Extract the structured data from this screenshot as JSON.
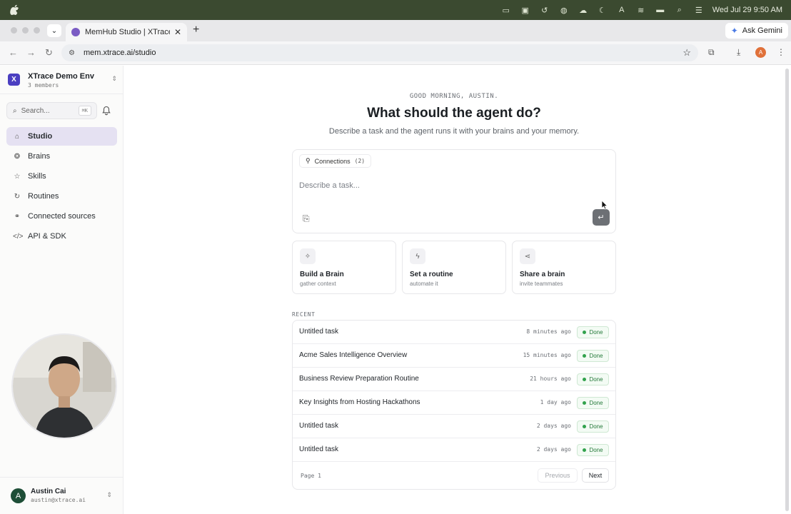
{
  "menubar": {
    "clock": "Wed Jul 29  9:50 AM"
  },
  "browser": {
    "tab_title": "MemHub Studio | XTrace Mem",
    "url": "mem.xtrace.ai/studio",
    "ask_gemini": "Ask Gemini",
    "profile_initial": "A"
  },
  "sidebar": {
    "workspace_logo": "X",
    "workspace_name": "XTrace Demo Env",
    "workspace_members": "3 members",
    "search_placeholder": "Search...",
    "search_shortcut": "⌘K",
    "items": [
      {
        "label": "Studio",
        "icon": "home-icon",
        "active": true
      },
      {
        "label": "Brains",
        "icon": "brain-icon"
      },
      {
        "label": "Skills",
        "icon": "star-icon"
      },
      {
        "label": "Routines",
        "icon": "refresh-icon"
      },
      {
        "label": "Connected sources",
        "icon": "link-icon"
      },
      {
        "label": "API & SDK",
        "icon": "code-icon"
      }
    ],
    "user": {
      "initial": "A",
      "name": "Austin Cai",
      "email": "austin@xtrace.ai"
    }
  },
  "main": {
    "greeting": "GOOD MORNING, AUSTIN.",
    "headline": "What should the agent do?",
    "subline": "Describe a task and the agent runs it with your brains and your memory.",
    "composer": {
      "connections_label": "Connections",
      "connections_count": "(2)",
      "placeholder": "Describe a task...",
      "value": ""
    },
    "cards": [
      {
        "title": "Build a Brain",
        "subtitle": "gather context",
        "icon": "sparkle-icon"
      },
      {
        "title": "Set a routine",
        "subtitle": "automate it",
        "icon": "bolt-icon"
      },
      {
        "title": "Share a brain",
        "subtitle": "invite teammates",
        "icon": "share-icon"
      }
    ],
    "recent_label": "RECENT",
    "recent": [
      {
        "title": "Untitled task",
        "time": "8 minutes ago",
        "status": "Done"
      },
      {
        "title": "Acme Sales Intelligence Overview",
        "time": "15 minutes ago",
        "status": "Done"
      },
      {
        "title": "Business Review Preparation Routine",
        "time": "21 hours ago",
        "status": "Done"
      },
      {
        "title": "Key Insights from Hosting Hackathons",
        "time": "1 day ago",
        "status": "Done"
      },
      {
        "title": "Untitled task",
        "time": "2 days ago",
        "status": "Done"
      },
      {
        "title": "Untitled task",
        "time": "2 days ago",
        "status": "Done"
      }
    ],
    "pager": {
      "page": "Page 1",
      "previous": "Previous",
      "next": "Next"
    }
  },
  "colors": {
    "accent": "#4b3fc1",
    "active_nav": "#e5e1f2",
    "done_green": "#257a3a"
  }
}
